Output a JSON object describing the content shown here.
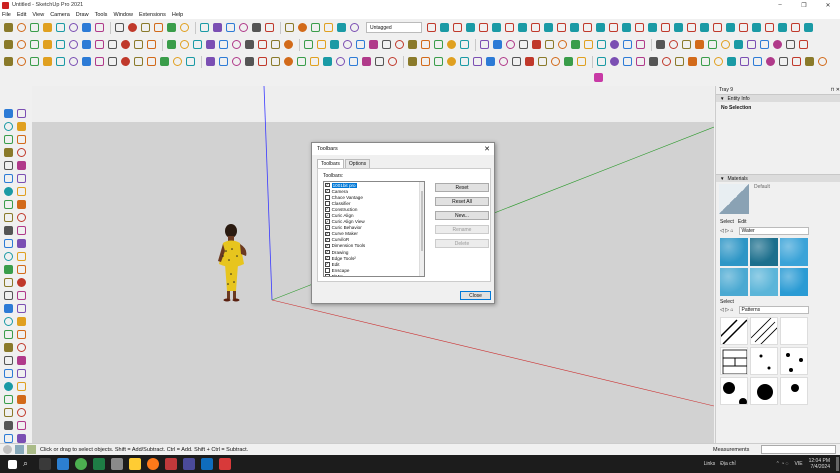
{
  "window": {
    "title": "Untitled - SketchUp Pro 2021",
    "minimize": "–",
    "maximize": "❐",
    "close": "✕"
  },
  "menu": [
    "File",
    "Edit",
    "View",
    "Camera",
    "Draw",
    "Tools",
    "Window",
    "Extensions",
    "Help"
  ],
  "toolbar": {
    "tag_value": "Untagged"
  },
  "dialog": {
    "title": "Toolbars",
    "close": "✕",
    "tabs": [
      "Toolbars",
      "Options"
    ],
    "list_label": "Toolbars:",
    "items": [
      {
        "label": "1001bit pro",
        "checked": true,
        "selected": true
      },
      {
        "label": "Camera",
        "checked": true
      },
      {
        "label": "Chace Vantage",
        "checked": false
      },
      {
        "label": "Classifier",
        "checked": false
      },
      {
        "label": "Construction",
        "checked": true
      },
      {
        "label": "Curic Align",
        "checked": true
      },
      {
        "label": "Curic Align View",
        "checked": true
      },
      {
        "label": "Curic Behavior",
        "checked": true
      },
      {
        "label": "Curve Maker",
        "checked": true
      },
      {
        "label": "CurviloR",
        "checked": true
      },
      {
        "label": "Dimension Tools",
        "checked": true
      },
      {
        "label": "Drawing",
        "checked": true
      },
      {
        "label": "Edge Tools²",
        "checked": true
      },
      {
        "label": "Edit",
        "checked": true
      },
      {
        "label": "Enscape",
        "checked": false
      },
      {
        "label": "FlMm",
        "checked": false
      }
    ],
    "buttons": {
      "reset": "Reset",
      "reset_all": "Reset All",
      "new": "New...",
      "rename": "Rename",
      "delete": "Delete",
      "close": "Close"
    }
  },
  "tray": {
    "title": "Tray 9",
    "entity_info": {
      "header": "Entity Info",
      "selection": "No Selection"
    },
    "materials": {
      "header": "Materials",
      "current": "Default",
      "tabs": [
        "Select",
        "Edit"
      ],
      "collection": "Water",
      "swatch_colors": [
        "#2e96c6",
        "#1c6f8d",
        "#3aa3d8",
        "#4aa9d2",
        "#5bb5d9",
        "#2a9bd4"
      ],
      "secondary_label": "Select",
      "secondary_collection": "Patterns"
    }
  },
  "status": {
    "hint": "Click or drag to select objects. Shift = Add/Subtract. Ctrl = Add. Shift + Ctrl = Subtract.",
    "measurements_label": "Measurements"
  },
  "taskbar": {
    "links": "Links",
    "location": "Địa chỉ",
    "lang": "VIE",
    "time": "12:04 PM",
    "date": "7/4/2024"
  }
}
